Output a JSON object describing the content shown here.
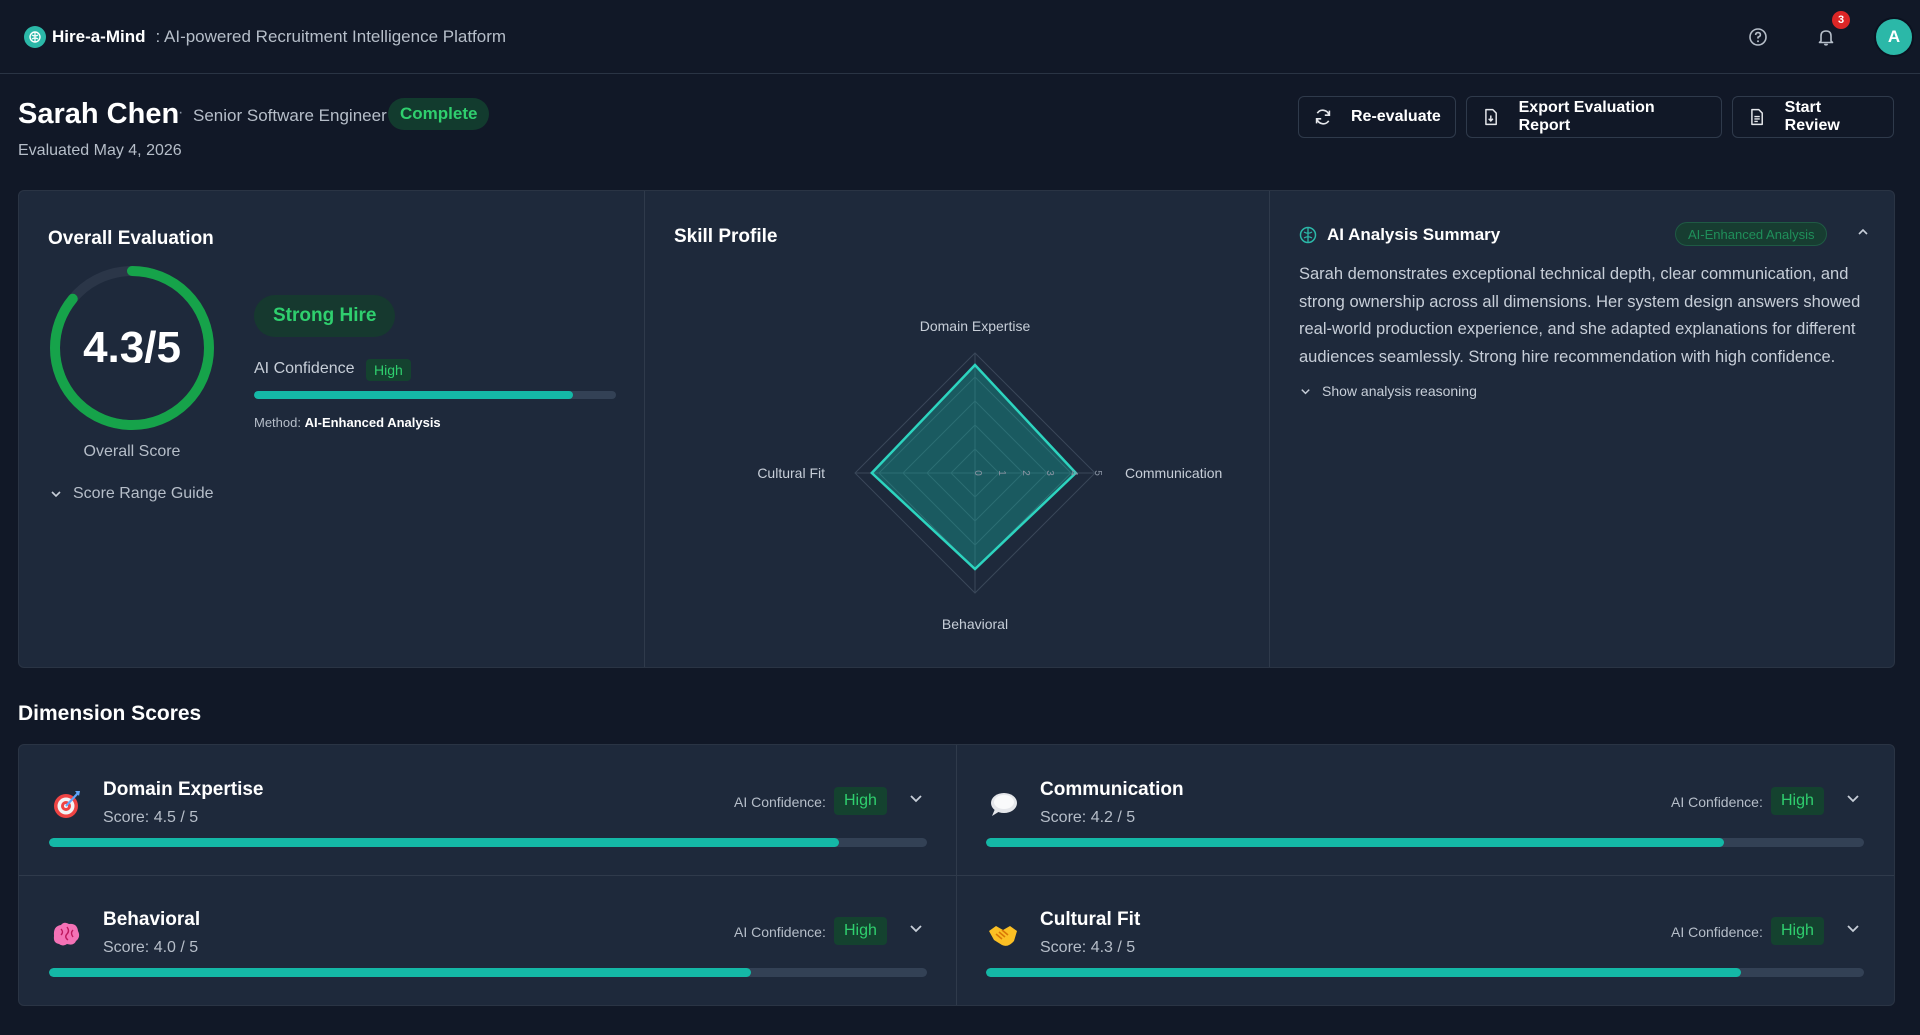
{
  "app": {
    "name": "Hire-a-Mind",
    "tagline": ": AI-powered Recruitment Intelligence Platform",
    "notification_count": "3",
    "user_initial": "A",
    "accent_color": "#14b8a6",
    "success_color": "#2fcf6e"
  },
  "candidate": {
    "name": "Sarah Chen",
    "separator": "·",
    "role": "Senior Software Engineer",
    "status": "Complete",
    "evaluated": "Evaluated May 4, 2026"
  },
  "actions": {
    "reevaluate": "Re-evaluate",
    "export": "Export Evaluation Report",
    "review": "Start Review"
  },
  "overall": {
    "title": "Overall Evaluation",
    "score_text": "4.3/5",
    "score_value": 4.3,
    "score_max": 5,
    "caption": "Overall Score",
    "range_guide": "Score Range Guide",
    "recommendation": "Strong Hire",
    "confidence_label": "AI Confidence",
    "confidence_level": "High",
    "confidence_fraction": 0.88,
    "method_label": "Method:",
    "method_value": "AI-Enhanced Analysis"
  },
  "skill_profile": {
    "title": "Skill Profile",
    "axes": [
      "Domain Expertise",
      "Communication",
      "Behavioral",
      "Cultural Fit"
    ],
    "values": [
      4.5,
      4.2,
      4.0,
      4.3
    ],
    "max": 5,
    "ticks": [
      "0",
      "1",
      "2",
      "3",
      "4",
      "5"
    ]
  },
  "ai_summary": {
    "title": "AI Analysis Summary",
    "badge": "AI-Enhanced Analysis",
    "body": "Sarah demonstrates exceptional technical depth, clear communication, and strong ownership across all dimensions. Her system design answers showed real-world production experience, and she adapted explanations for different audiences seamlessly. Strong hire recommendation with high confidence.",
    "reasoning_toggle": "Show analysis reasoning"
  },
  "dimensions": {
    "heading": "Dimension Scores",
    "confidence_label": "AI Confidence:",
    "items": [
      {
        "name": "Domain Expertise",
        "score": "Score: 4.5 / 5",
        "value": 4.5,
        "confidence": "High",
        "icon": "target-icon"
      },
      {
        "name": "Communication",
        "score": "Score: 4.2 / 5",
        "value": 4.2,
        "confidence": "High",
        "icon": "speech-bubble-icon"
      },
      {
        "name": "Behavioral",
        "score": "Score: 4.0 / 5",
        "value": 4.0,
        "confidence": "High",
        "icon": "brain-icon"
      },
      {
        "name": "Cultural Fit",
        "score": "Score: 4.3 / 5",
        "value": 4.3,
        "confidence": "High",
        "icon": "handshake-icon"
      }
    ]
  }
}
